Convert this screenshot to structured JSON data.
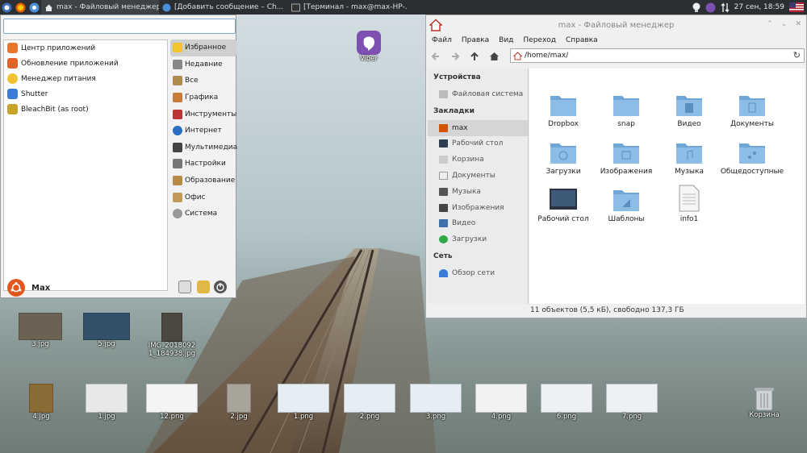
{
  "panel": {
    "tasks": [
      {
        "label": "max - Файловый менеджер"
      },
      {
        "label": "[Добавить сообщение – Ch..."
      },
      {
        "label": "[Терминал - max@max-HP-..."
      }
    ],
    "clock": "27 сен, 18:59"
  },
  "menu": {
    "search_placeholder": "",
    "apps": [
      {
        "label": "Центр приложений",
        "color": "#e8772e"
      },
      {
        "label": "Обновление приложений",
        "color": "#e0642a"
      },
      {
        "label": "Менеджер питания",
        "color": "#f1c232"
      },
      {
        "label": "Shutter",
        "color": "#3a7bd5"
      },
      {
        "label": "BleachBit (as root)",
        "color": "#c9a227"
      }
    ],
    "categories": [
      {
        "label": "Избранное",
        "color": "#f4c430"
      },
      {
        "label": "Недавние",
        "color": "#888888"
      },
      {
        "label": "Все",
        "color": "#b08a4a"
      },
      {
        "label": "Графика",
        "color": "#c77c3a"
      },
      {
        "label": "Инструменты",
        "color": "#b33"
      },
      {
        "label": "Интернет",
        "color": "#2a6fc4"
      },
      {
        "label": "Мультимедиа",
        "color": "#444"
      },
      {
        "label": "Настройки",
        "color": "#777"
      },
      {
        "label": "Образование",
        "color": "#b5894a"
      },
      {
        "label": "Офис",
        "color": "#c29a58"
      },
      {
        "label": "Система",
        "color": "#999"
      }
    ],
    "user": "Max"
  },
  "desktop": {
    "viber_label": "Viber",
    "trash_label": "Корзина",
    "files": [
      {
        "label": "3.jpg"
      },
      {
        "label": "5.jpg"
      },
      {
        "label": "IMG_20180921_184938.jpg"
      },
      {
        "label": "4.jpg"
      },
      {
        "label": "1.jpg"
      },
      {
        "label": "12.png"
      },
      {
        "label": "2.jpg"
      },
      {
        "label": "1.png"
      },
      {
        "label": "2.png"
      },
      {
        "label": "3.png"
      },
      {
        "label": "4.png"
      },
      {
        "label": "6.png"
      },
      {
        "label": "7.png"
      }
    ]
  },
  "fm": {
    "title": "max - Файловый менеджер",
    "menubar": [
      "Файл",
      "Правка",
      "Вид",
      "Переход",
      "Справка"
    ],
    "path": "/home/max/",
    "side": {
      "devices_head": "Устройства",
      "filesystem": "Файловая система",
      "bookmarks_head": "Закладки",
      "bookmarks": [
        "max",
        "Рабочий стол",
        "Корзина",
        "Документы",
        "Музыка",
        "Изображения",
        "Видео",
        "Загрузки"
      ],
      "network_head": "Сеть",
      "network": "Обзор сети"
    },
    "items": [
      {
        "label": "Dropbox"
      },
      {
        "label": "snap"
      },
      {
        "label": "Видео"
      },
      {
        "label": "Документы"
      },
      {
        "label": "Загрузки"
      },
      {
        "label": "Изображения"
      },
      {
        "label": "Музыка"
      },
      {
        "label": "Общедоступные"
      },
      {
        "label": "Рабочий стол"
      },
      {
        "label": "Шаблоны"
      },
      {
        "label": "info1"
      }
    ],
    "status": "11 объектов (5,5 кБ), свободно 137,3 ГБ"
  }
}
